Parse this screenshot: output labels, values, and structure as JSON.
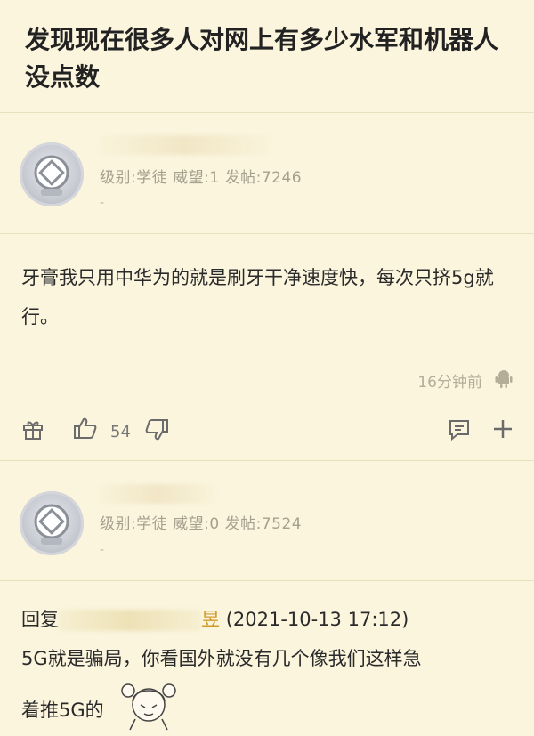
{
  "thread": {
    "title": "发现现在很多人对网上有多少水军和机器人没点数"
  },
  "posts": [
    {
      "meta": "级别:学徒 威望:1 发帖:7246",
      "signature": "-",
      "content": "牙膏我只用中华为的就是刷牙干净速度快，每次只挤5g就行。",
      "time": "16分钟前",
      "likes": "54"
    },
    {
      "meta": "级别:学徒 威望:0 发帖:7524",
      "signature": "-",
      "reply_prefix": "回复",
      "reply_tail": "昱",
      "reply_date": "(2021-10-13 17:12)",
      "content_line1": "5G就是骗局，你看国外就没有几个像我们这样急",
      "content_line2": "着推5G的"
    }
  ],
  "icons": [
    "user-avatar-icon",
    "android-icon",
    "gift-icon",
    "thumbs-up-icon",
    "thumbs-down-icon",
    "comment-icon",
    "plus-icon",
    "emoji-sticker-icon"
  ]
}
